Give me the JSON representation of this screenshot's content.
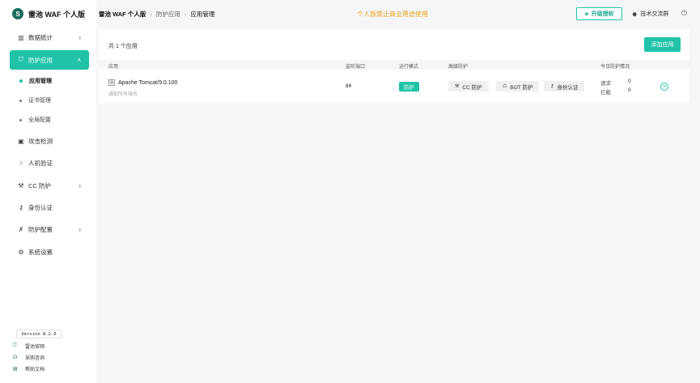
{
  "app": {
    "logo_mark": "S",
    "title": "雷池 WAF 个人版"
  },
  "sidebar": {
    "items": [
      {
        "label": "数据统计",
        "icon": "bar-chart-icon",
        "glyph": "▥",
        "has_children": true
      },
      {
        "label": "防护应用",
        "icon": "shield-icon",
        "glyph": "⛉",
        "has_children": true,
        "active": true
      },
      {
        "label": "攻击检测",
        "icon": "detect-icon",
        "glyph": "▣"
      },
      {
        "label": "人机验证",
        "icon": "hand-icon",
        "glyph": "☝"
      },
      {
        "label": "CC 防护",
        "icon": "wrench-icon",
        "glyph": "⚒",
        "has_children": true
      },
      {
        "label": "身份认证",
        "icon": "key-icon",
        "glyph": "⚷"
      },
      {
        "label": "防护配置",
        "icon": "tools-icon",
        "glyph": "✗",
        "has_children": true
      },
      {
        "label": "系统设置",
        "icon": "gear-icon",
        "glyph": "⚙"
      }
    ],
    "submenu": [
      {
        "label": "应用管理",
        "current": true
      },
      {
        "label": "证书管理"
      },
      {
        "label": "全局配置"
      }
    ],
    "chevron_right": "›",
    "chevron_up": "˄",
    "version": "Version 8.2.0",
    "footer_links": [
      {
        "label": "雷池官网",
        "glyph": "⛉"
      },
      {
        "label": "采购咨询",
        "glyph": "☊"
      },
      {
        "label": "帮助文档",
        "glyph": "▤"
      }
    ]
  },
  "header": {
    "breadcrumb": [
      "雷池 WAF 个人版",
      "防护应用",
      "应用管理"
    ],
    "breadcrumb_sep": "›",
    "notice": "个人版禁止商业用途使用",
    "upgrade_label": "升级授权",
    "upgrade_glyph": "◈",
    "group_label": "技术交流群",
    "group_glyph": "☻",
    "logout_glyph": "⏻"
  },
  "panel": {
    "total_text": "共 1 个应用",
    "add_label": "添加应用",
    "columns": [
      "应用",
      "监听端口",
      "运行模式",
      "高级防护",
      "今日防护情况"
    ],
    "rows": [
      {
        "name": "Apache Tomcat/9.0.100",
        "domain": "通配所有域名",
        "port": "80",
        "mode": "防护",
        "features": [
          {
            "label": "CC 防护",
            "glyph": "⚒"
          },
          {
            "label": "BOT 防护",
            "glyph": "♺"
          },
          {
            "label": "身份认证",
            "glyph": "⚷"
          }
        ],
        "stats": [
          {
            "label": "请求",
            "value": "0"
          },
          {
            "label": "拦截",
            "value": "0"
          }
        ],
        "more_glyph": "•••"
      }
    ]
  },
  "colors": {
    "accent": "#20c3a8",
    "notice": "#e8a317",
    "brand_dark": "#1a6b5e"
  }
}
